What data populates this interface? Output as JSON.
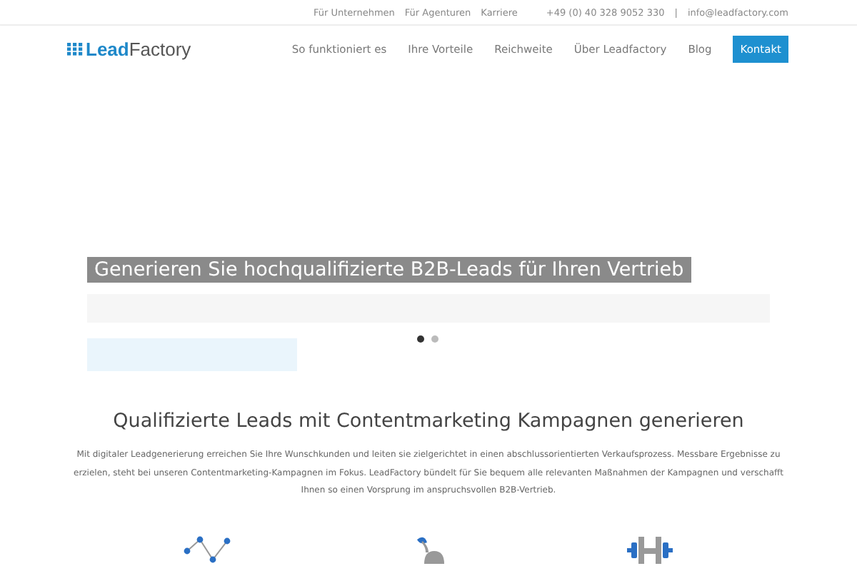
{
  "top_bar": {
    "links": [
      "Für Unternehmen",
      "Für Agenturen",
      "Karriere"
    ],
    "phone": "+49 (0) 40 328 9052 330",
    "separator": "|",
    "email": "info@leadfactory.com"
  },
  "header": {
    "logo": {
      "part1": "Lead",
      "part2": "Factory"
    },
    "nav": [
      {
        "label": "So funktioniert es",
        "kind": "link"
      },
      {
        "label": "Ihre Vorteile",
        "kind": "link"
      },
      {
        "label": "Reichweite",
        "kind": "link"
      },
      {
        "label": "Über Leadfactory",
        "kind": "link"
      },
      {
        "label": "Blog",
        "kind": "link"
      },
      {
        "label": "Kontakt",
        "kind": "button"
      }
    ]
  },
  "hero": {
    "headline": "Generieren Sie hochqualifizierte B2B-Leads für Ihren Vertrieb",
    "dots": [
      {
        "selected": true
      },
      {
        "selected": false
      }
    ]
  },
  "intro": {
    "title": "Qualifizierte Leads mit Contentmarketing Kampagnen generieren",
    "text": "Mit digitaler Leadgenerierung erreichen Sie Ihre Wunschkunden und leiten sie zielgerichtet in einen abschlussorientierten Verkaufsprozess. Messbare Ergebnisse zu erzielen, steht bei unseren Contentmarketing-Kampagnen im Fokus. LeadFactory bündelt für Sie bequem alle relevanten Maßnahmen der Kampagnen und verschafft Ihnen so einen Vorsprung im anspruchsvollen B2B-Vertrieb."
  },
  "features": [
    {
      "kind": "chart"
    },
    {
      "kind": "plant"
    },
    {
      "kind": "dumbbell"
    }
  ]
}
